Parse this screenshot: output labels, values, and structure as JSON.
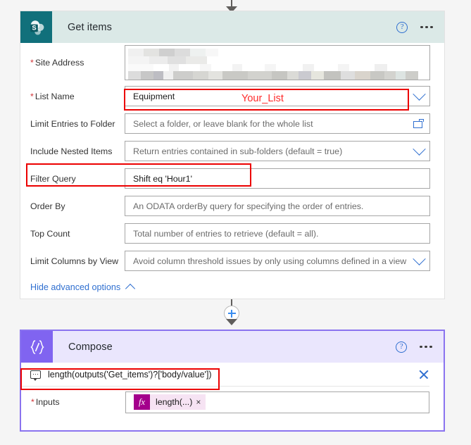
{
  "connectors": {
    "top_arrow": "arrow-down-icon",
    "mid_plus": "plus-circle-icon",
    "mid_arrow": "arrow-down-icon",
    "compose_arrow": "arrow-down-icon"
  },
  "get_items_card": {
    "icon_name": "sharepoint-icon",
    "title": "Get items",
    "help_label": "?",
    "header_color": "#dbe9e7",
    "icon_color": "#11707b",
    "fields": [
      {
        "label": "Site Address",
        "required": true,
        "value": "",
        "placeholder": "",
        "redacted": true,
        "trailing_icon": ""
      },
      {
        "label": "List Name",
        "required": true,
        "value": "Equipment",
        "placeholder": "",
        "redacted": false,
        "trailing_icon": "chevron-down-icon"
      },
      {
        "label": "Limit Entries to Folder",
        "required": false,
        "value": "",
        "placeholder": "Select a folder, or leave blank for the whole list",
        "redacted": false,
        "trailing_icon": "folder-picker-icon"
      },
      {
        "label": "Include Nested Items",
        "required": false,
        "value": "",
        "placeholder": "Return entries contained in sub-folders (default = true)",
        "redacted": false,
        "trailing_icon": "chevron-down-icon"
      },
      {
        "label": "Filter Query",
        "required": false,
        "value": "Shift eq 'Hour1'",
        "placeholder": "",
        "redacted": false,
        "trailing_icon": ""
      },
      {
        "label": "Order By",
        "required": false,
        "value": "",
        "placeholder": "An ODATA orderBy query for specifying the order of entries.",
        "redacted": false,
        "trailing_icon": ""
      },
      {
        "label": "Top Count",
        "required": false,
        "value": "",
        "placeholder": "Total number of entries to retrieve (default = all).",
        "redacted": false,
        "trailing_icon": ""
      },
      {
        "label": "Limit Columns by View",
        "required": false,
        "value": "",
        "placeholder": "Avoid column threshold issues by only using columns defined in a view",
        "redacted": false,
        "trailing_icon": "chevron-down-icon"
      }
    ],
    "advanced_link": "Hide advanced options"
  },
  "compose_card": {
    "icon_name": "compose-braces-icon",
    "icon_glyph": "{/}",
    "title": "Compose",
    "help_label": "?",
    "header_color": "#eae6fd",
    "icon_color": "#8064f0",
    "border_color": "#8a73ef",
    "expression_bar": {
      "icon_name": "expression-tooltip-icon",
      "text": "length(outputs('Get_items')?['body/value'])",
      "close_icon": "close-icon"
    },
    "inputs_row": {
      "label": "Inputs",
      "required": true,
      "token": {
        "fx": "fx",
        "label": "length(...)",
        "remove": "×"
      }
    }
  },
  "annotations": {
    "list_name_note": "Your_List",
    "note_color": "#ff2a2a",
    "box_color": "#ec0000"
  }
}
